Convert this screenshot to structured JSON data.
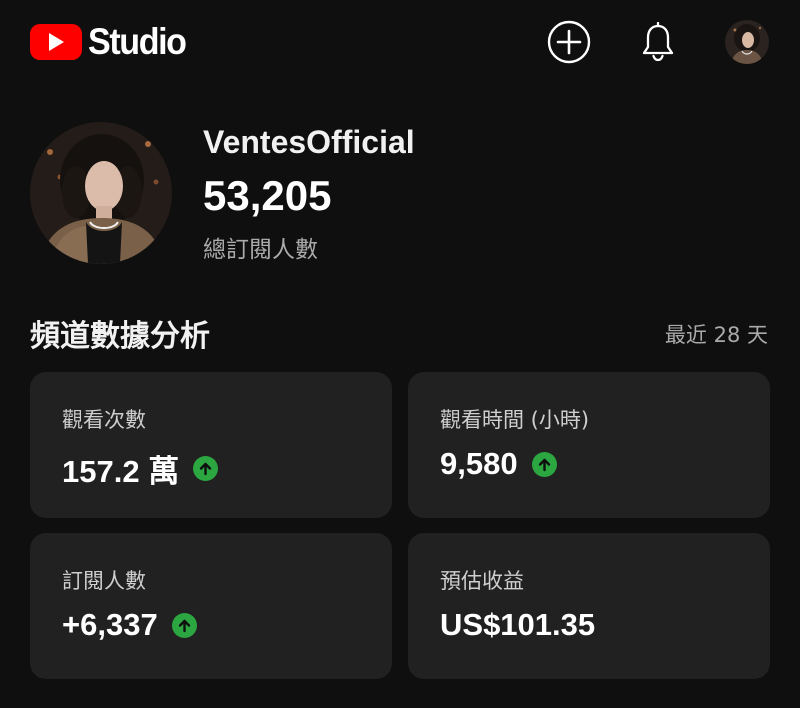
{
  "app": {
    "logo_text": "Studio",
    "logo_icon": "youtube-play-icon"
  },
  "header": {
    "create_icon": "plus-circle-icon",
    "notifications_icon": "bell-icon",
    "avatar_icon": "user-avatar"
  },
  "channel": {
    "name": "VentesOfficial",
    "subscribers": "53,205",
    "subscribers_label": "總訂閱人數"
  },
  "analytics": {
    "title": "頻道數據分析",
    "range": "最近 28 天",
    "cards": [
      {
        "label": "觀看次數",
        "value": "157.2 萬",
        "trend": "up"
      },
      {
        "label": "觀看時間 (小時)",
        "value": "9,580",
        "trend": "up"
      },
      {
        "label": "訂閱人數",
        "value": "+6,337",
        "trend": "up"
      },
      {
        "label": "預估收益",
        "value": "US$101.35",
        "trend": "none"
      }
    ]
  },
  "colors": {
    "background": "#0f0f0f",
    "card": "#212121",
    "brand_red": "#ff0000",
    "trend_up": "#2ba640",
    "secondary_text": "#aaaaaa"
  }
}
